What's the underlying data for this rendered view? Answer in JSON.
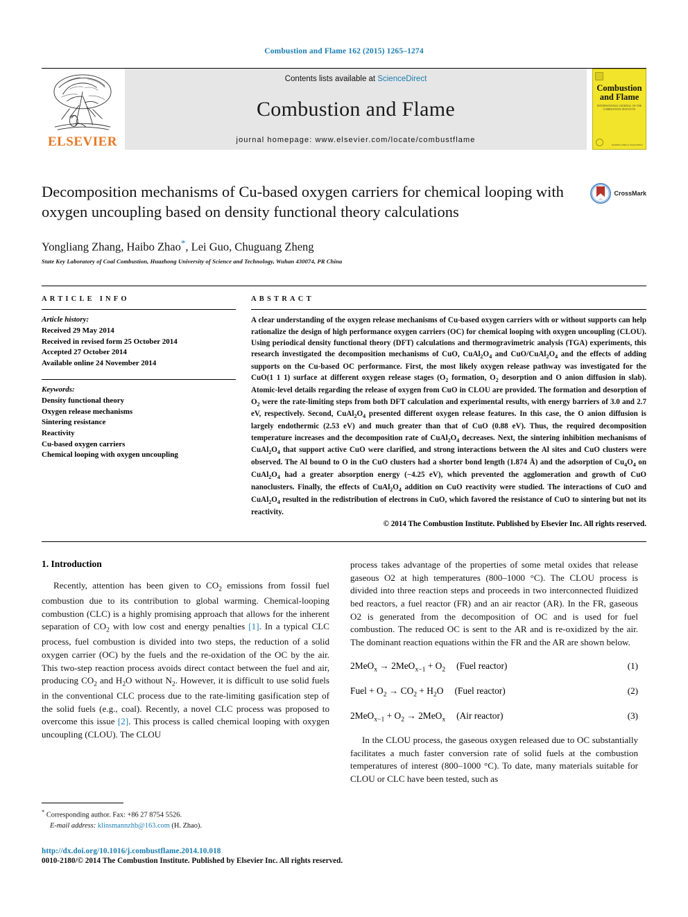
{
  "running_head": "Combustion and Flame 162 (2015) 1265–1274",
  "masthead": {
    "publisher": "ELSEVIER",
    "contents_prefix": "Contents lists available at ",
    "contents_link": "ScienceDirect",
    "journal_name": "Combustion and Flame",
    "homepage": "journal homepage: www.elsevier.com/locate/combustflame",
    "cover_title": "Combustion and Flame",
    "cover_sub": "INTERNATIONAL JOURNAL OF THE COMBUSTION INSTITUTE",
    "cover_foot": "Available online at\nScienceDirect"
  },
  "article": {
    "title": "Decomposition mechanisms of Cu-based oxygen carriers for chemical looping with oxygen uncoupling based on density functional theory calculations",
    "authors": "Yongliang Zhang, Haibo Zhao",
    "authors_rest": ", Lei Guo, Chuguang Zheng",
    "corresponding_marker": "*",
    "affiliation": "State Key Laboratory of Coal Combustion, Huazhong University of Science and Technology, Wuhan 430074, PR China",
    "crossmark_label": "CrossMark"
  },
  "info": {
    "heading": "ARTICLE INFO",
    "history_label": "Article history:",
    "history": [
      "Received 29 May 2014",
      "Received in revised form 25 October 2014",
      "Accepted 27 October 2014",
      "Available online 24 November 2014"
    ],
    "keywords_label": "Keywords:",
    "keywords": [
      "Density functional theory",
      "Oxygen release mechanisms",
      "Sintering resistance",
      "Reactivity",
      "Cu-based oxygen carriers",
      "Chemical looping with oxygen uncoupling"
    ]
  },
  "abstract": {
    "heading": "ABSTRACT",
    "paragraphs": [
      "A clear understanding of the oxygen release mechanisms of Cu-based oxygen carriers with or without supports can help rationalize the design of high performance oxygen carriers (OC) for chemical looping with oxygen uncoupling (CLOU). Using periodical density functional theory (DFT) calculations and thermogravimetric analysis (TGA) experiments, this research investigated the decomposition mechanisms of CuO, CuAl2O4 and CuO/CuAl2O4 and the effects of adding supports on the Cu-based OC performance. First, the most likely oxygen release pathway was investigated for the CuO(1 1 1) surface at different oxygen release stages (O2 formation, O2 desorption and O anion diffusion in slab). Atomic-level details regarding the release of oxygen from CuO in CLOU are provided. The formation and desorption of O2 were the rate-limiting steps from both DFT calculation and experimental results, with energy barriers of 3.0 and 2.7 eV, respectively. Second, CuAl2O4 presented different oxygen release features. In this case, the O anion diffusion is largely endothermic (2.53 eV) and much greater than that of CuO (0.88 eV). Thus, the required decomposition temperature increases and the decomposition rate of CuAl2O4 decreases. Next, the sintering inhibition mechanisms of CuAl2O4 that support active CuO were clarified, and strong interactions between the Al sites and CuO clusters were observed. The Al bound to O in the CuO clusters had a shorter bond length (1.874 Å) and the adsorption of Cu4O4 on CuAl2O4 had a greater absorption energy (−4.25 eV), which prevented the agglomeration and growth of CuO nanoclusters. Finally, the effects of CuAl2O4 addition on CuO reactivity were studied. The interactions of CuO and CuAl2O4 resulted in the redistribution of electrons in CuO, which favored the resistance of CuO to sintering but not its reactivity."
    ],
    "copyright": "© 2014 The Combustion Institute. Published by Elsevier Inc. All rights reserved."
  },
  "body": {
    "section_heading": "1. Introduction",
    "left_paragraph_a": "Recently, attention has been given to CO2 emissions from fossil fuel combustion due to its contribution to global warming. Chemical-looping combustion (CLC) is a highly promising approach that allows for the inherent separation of CO2 with low cost and energy penalties ",
    "left_ref_1": "[1]",
    "left_paragraph_b": ". In a typical CLC process, fuel combustion is divided into two steps, the reduction of a solid oxygen carrier (OC) by the fuels and the re-oxidation of the OC by the air. This two-step reaction process avoids direct contact between the fuel and air, producing CO2 and H2O without N2. However, it is difficult to use solid fuels in the conventional CLC process due to the rate-limiting gasification step of the solid fuels (e.g., coal). Recently, a novel CLC process was proposed to overcome this issue ",
    "left_ref_2": "[2]",
    "left_paragraph_c": ". This process is called chemical looping with oxygen uncoupling (CLOU). The CLOU",
    "right_paragraph_a": "process takes advantage of the properties of some metal oxides that release gaseous O2 at high temperatures (800–1000 °C). The CLOU process is divided into three reaction steps and proceeds in two interconnected fluidized bed reactors, a fuel reactor (FR) and an air reactor (AR). In the FR, gaseous O2 is generated from the decomposition of OC and is used for fuel combustion. The reduced OC is sent to the AR and is re-oxidized by the air. The dominant reaction equations within the FR and the AR are shown below.",
    "equations": [
      {
        "formula": "2MeOx → 2MeOx−1 + O2",
        "reactor": "(Fuel reactor)",
        "number": "(1)"
      },
      {
        "formula": "Fuel + O2 → CO2 + H2O",
        "reactor": "(Fuel reactor)",
        "number": "(2)"
      },
      {
        "formula": "2MeOx−1 + O2 → 2MeOx",
        "reactor": "(Air reactor)",
        "number": "(3)"
      }
    ],
    "right_paragraph_b": "In the CLOU process, the gaseous oxygen released due to OC substantially facilitates a much faster conversion rate of solid fuels at the combustion temperatures of interest (800–1000 °C). To date, many materials suitable for CLOU or CLC have been tested, such as"
  },
  "footnotes": {
    "corresponding": "Corresponding author. Fax: +86 27 8754 5526.",
    "email_label": "E-mail address:",
    "email": "klinsmannzhb@163.com",
    "email_suffix": " (H. Zhao).",
    "doi": "http://dx.doi.org/10.1016/j.combustflame.2014.10.018",
    "issn": "0010-2180/© 2014 The Combustion Institute. Published by Elsevier Inc. All rights reserved."
  },
  "colors": {
    "link": "#1a7cb0",
    "elsevier_orange": "#E87722",
    "band_gray": "#e6e6e6",
    "cover_yellow": "#f2e42a"
  }
}
